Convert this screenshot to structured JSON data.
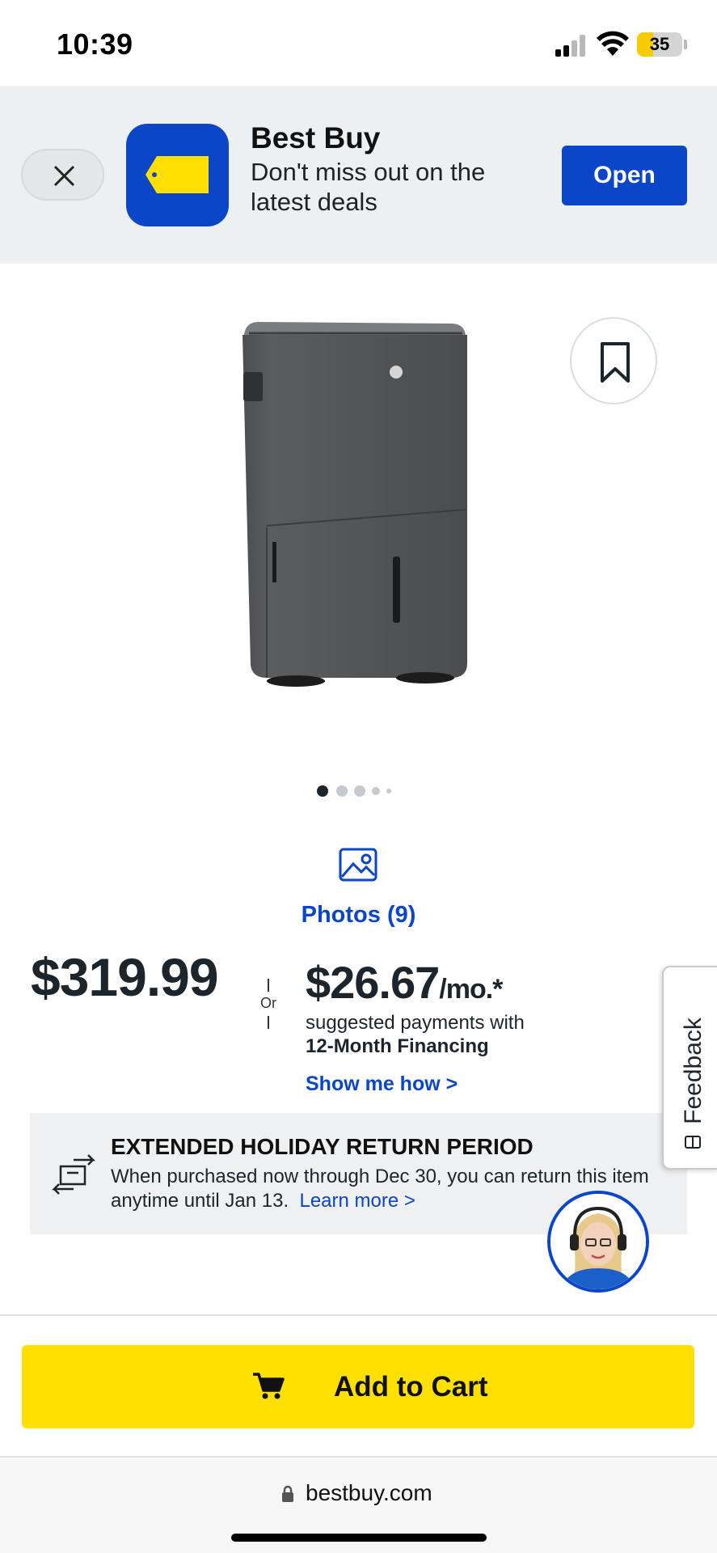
{
  "status_bar": {
    "time": "10:39",
    "battery": "35"
  },
  "app_banner": {
    "title": "Best Buy",
    "subtitle": "Don't miss out on the latest deals",
    "open_label": "Open"
  },
  "gallery": {
    "photos_label": "Photos (9)",
    "page_count": 5,
    "current_page": 1
  },
  "pricing": {
    "price": "$319.99",
    "or_label": "Or",
    "monthly_amount": "$26.67",
    "monthly_suffix": "/mo.*",
    "financing_line1": "suggested payments with",
    "financing_line2": "12-Month Financing",
    "show_me_how": "Show me how >"
  },
  "feedback": {
    "label": "Feedback"
  },
  "return_notice": {
    "title": "EXTENDED HOLIDAY RETURN PERIOD",
    "body": "When purchased now through Dec 30, you can return this item anytime until Jan 13.",
    "link": "Learn more >"
  },
  "cart": {
    "label": "Add to Cart"
  },
  "browser": {
    "url": "bestbuy.com"
  },
  "colors": {
    "brand_blue": "#0a46c7",
    "brand_yellow": "#ffe000",
    "text_dark": "#1d252c"
  }
}
